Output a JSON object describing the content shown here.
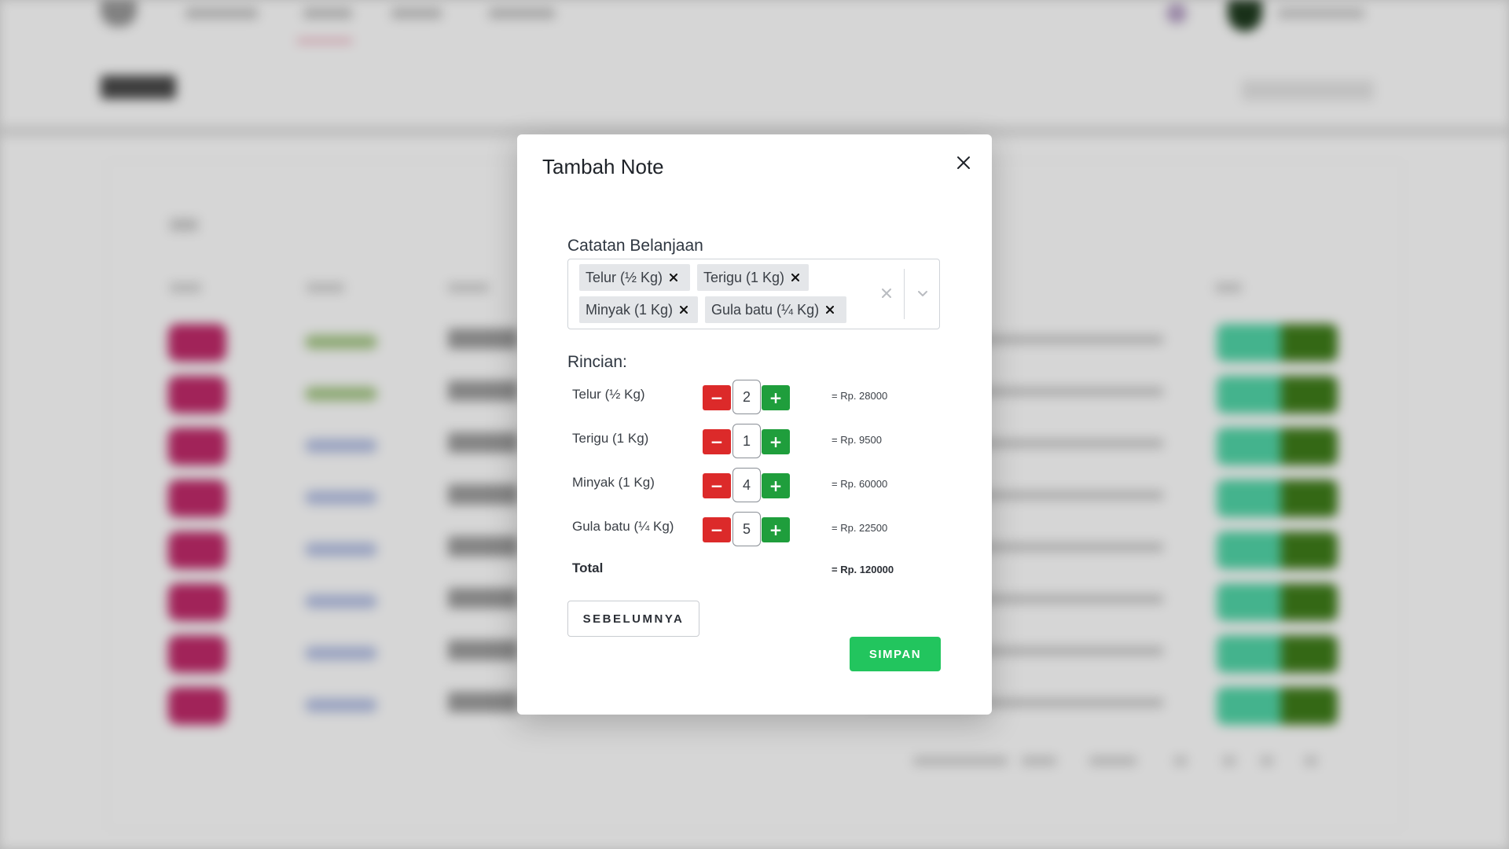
{
  "modal": {
    "title": "Tambah Note",
    "field_label": "Catatan Belanjaan",
    "selected_items": [
      {
        "label": "Telur (½ Kg)"
      },
      {
        "label": "Terigu (1 Kg)"
      },
      {
        "label": "Minyak (1 Kg)"
      },
      {
        "label": "Gula batu (¼ Kg)"
      }
    ],
    "rincian_heading": "Rincian:",
    "details": [
      {
        "name": "Telur (½ Kg)",
        "minus": "−",
        "qty": "2",
        "plus": "+",
        "price": "= Rp. 28000"
      },
      {
        "name": "Terigu (1 Kg)",
        "minus": "−",
        "qty": "1",
        "plus": "+",
        "price": "= Rp. 9500"
      },
      {
        "name": "Minyak (1 Kg)",
        "minus": "−",
        "qty": "4",
        "plus": "+",
        "price": "= Rp. 60000"
      },
      {
        "name": "Gula batu (¼ Kg)",
        "minus": "−",
        "qty": "5",
        "plus": "+",
        "price": "= Rp. 22500"
      }
    ],
    "total_label": "Total",
    "total_value": "= Rp. 120000",
    "prev_button": "SEBELUMNYA",
    "save_button": "SIMPAN",
    "icons": {
      "close": "close-icon",
      "chip_remove": "x-icon",
      "clear": "clear-icon",
      "dropdown": "chevron-down-icon"
    }
  },
  "colors": {
    "minus_button": "#dc2a2a",
    "plus_button": "#1f9e3c",
    "save_button": "#22c55e",
    "chip_background": "#e4e6e9"
  }
}
